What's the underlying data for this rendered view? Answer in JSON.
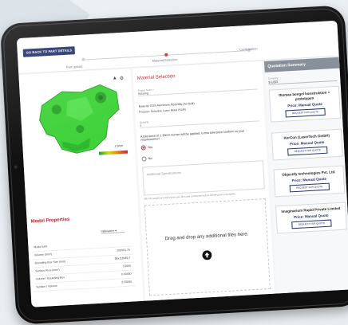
{
  "topbar": {
    "back_label": "GO BACK TO PART DETAILS",
    "steps": [
      "Part upload",
      "Material Selection",
      "Confirmation"
    ]
  },
  "viewer": {
    "legend_value": "2.5mm",
    "icons": [
      "cube-icon",
      "settings-icon"
    ]
  },
  "model_properties": {
    "title": "Model Properties",
    "units": "millimeters ▾",
    "rows": [
      {
        "label": "Model Unit",
        "value": ""
      },
      {
        "label": "Volume (mm³)",
        "value": "205561.76"
      },
      {
        "label": "Bounding Box Size (mm)",
        "value": "88x118x49.7"
      },
      {
        "label": "Surface Area (mm²)",
        "value": "51565"
      },
      {
        "label": "Volume / Bounding Box",
        "value": "0.40450"
      },
      {
        "label": "Surface / Volume",
        "value": "0.25066"
      }
    ]
  },
  "material": {
    "title": "Material Selection",
    "project_label": "Project Name *",
    "project_value": "Housing",
    "material_line": "Material: EOS Aluminium AlSi10Mg (As Built)",
    "process_line": "Process: Selective Laser Metal (SLM)",
    "quantity_label": "Quantity",
    "quantity_value": "1",
    "tolerance_question": "A tolerance of ± 300.0 micron will be applied. Is this tolerance conform to your requirements?",
    "yes": "Yes",
    "no": "No",
    "spec_placeholder": "Additional Specifications",
    "spec_note": "NB: Our engineers will review your files and comments before sending you a quotation.",
    "drop_text": "Drag and drop any additional files here."
  },
  "quotation": {
    "title": "Quotation Summary",
    "currency_label": "Currency",
    "currency_value": "$ USD",
    "suppliers": [
      {
        "name": "thomas bengel konstruktion + prototypen",
        "price": "Price: Manual Quote",
        "button": "REQUEST FOR QUOTE"
      },
      {
        "name": "KerCon (LaserTech GmbH)",
        "price": "Price: Manual Quote",
        "button": "REQUEST FOR QUOTE"
      },
      {
        "name": "Objectify technologies Pvt. Ltd.",
        "price": "Price: Manual Quote",
        "button": "REQUEST FOR QUOTE"
      },
      {
        "name": "Imaginarium Rapid Private Limited",
        "price": "Price: Manual Quote",
        "button": "REQUEST FOR QUOTE"
      }
    ]
  },
  "colors": {
    "accent_red": "#d8272f",
    "navy": "#22306b",
    "part_green": "#3fd23a",
    "tablet_frame": "#0f0f10"
  }
}
